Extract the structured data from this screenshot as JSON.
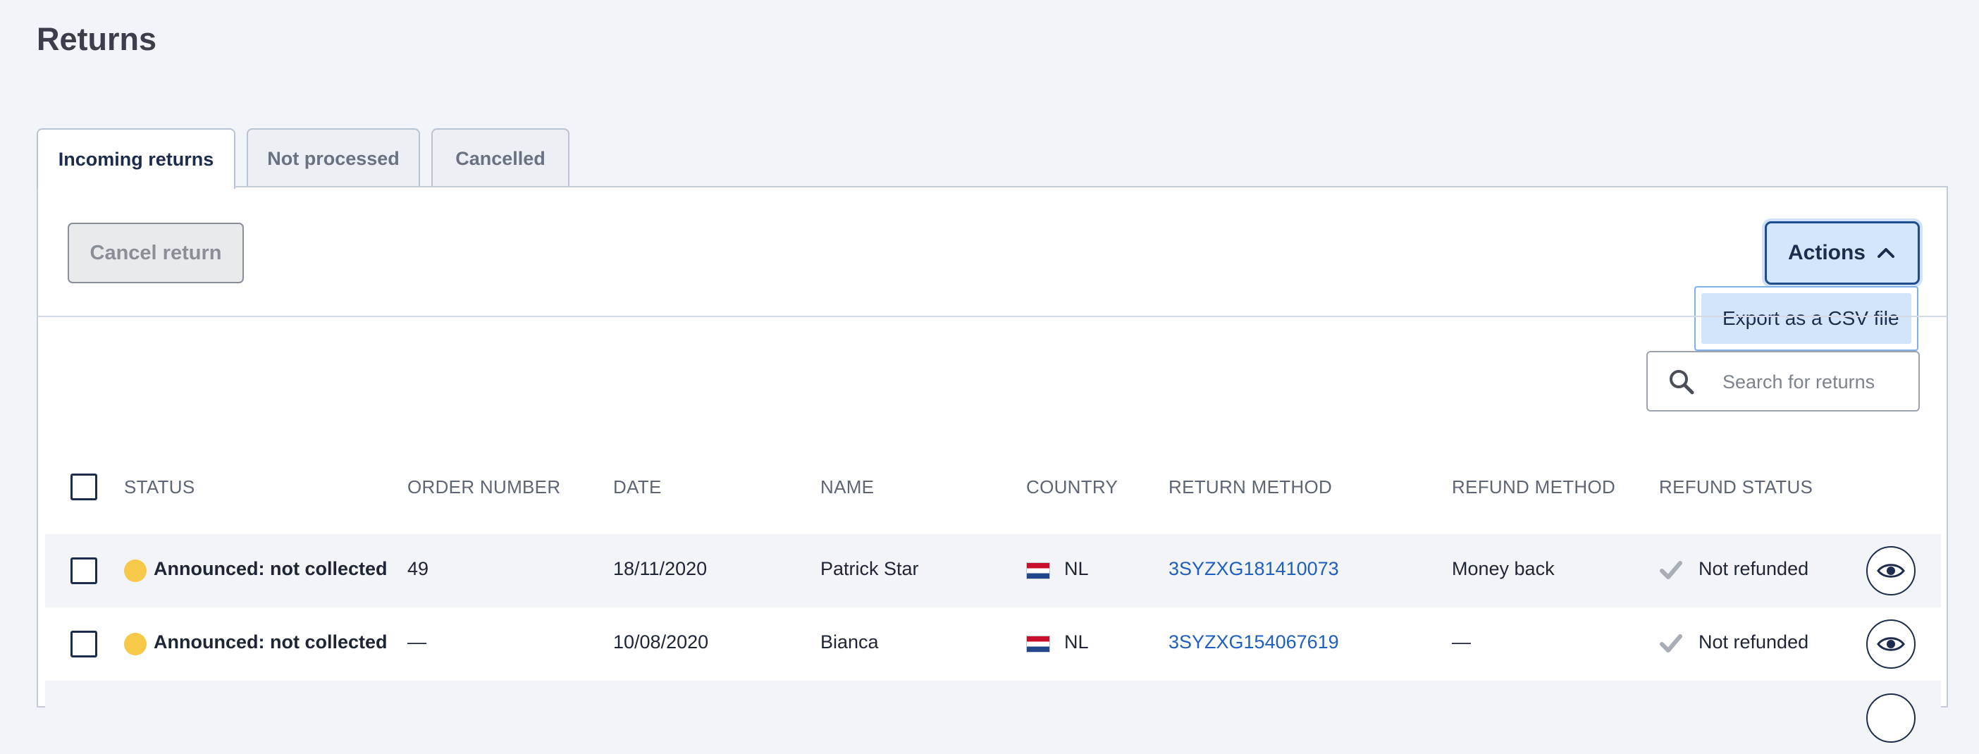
{
  "page": {
    "title": "Returns"
  },
  "tabs": [
    {
      "label": "Incoming returns",
      "active": true
    },
    {
      "label": "Not processed",
      "active": false
    },
    {
      "label": "Cancelled",
      "active": false
    }
  ],
  "toolbar": {
    "cancel_label": "Cancel return",
    "actions_label": "Actions",
    "actions_menu": [
      {
        "label": "Export as a CSV file"
      }
    ]
  },
  "search": {
    "placeholder": "Search for returns",
    "value": ""
  },
  "table": {
    "columns": [
      "STATUS",
      "ORDER NUMBER",
      "DATE",
      "NAME",
      "COUNTRY",
      "RETURN METHOD",
      "REFUND METHOD",
      "REFUND STATUS"
    ],
    "rows": [
      {
        "status": "Announced: not collected",
        "order_number": "49",
        "date": "18/11/2020",
        "name": "Patrick Star",
        "country": "NL",
        "return_method": "3SYZXG181410073",
        "refund_method": "Money back",
        "refund_status": "Not refunded"
      },
      {
        "status": "Announced: not collected",
        "order_number": "—",
        "date": "10/08/2020",
        "name": "Bianca",
        "country": "NL",
        "return_method": "3SYZXG154067619",
        "refund_method": "—",
        "refund_status": "Not refunded"
      }
    ]
  },
  "colors": {
    "status_dot": "#f7c948",
    "link": "#1f5fbf",
    "accent": "#1f4c8f",
    "background": "#f1f5fa"
  },
  "icons": {
    "search": "search-icon",
    "actions_chevron": "chevron-up-icon",
    "refund_status": "checkmark-icon",
    "view": "eye-icon",
    "country_flag": "flag-nl-icon"
  }
}
